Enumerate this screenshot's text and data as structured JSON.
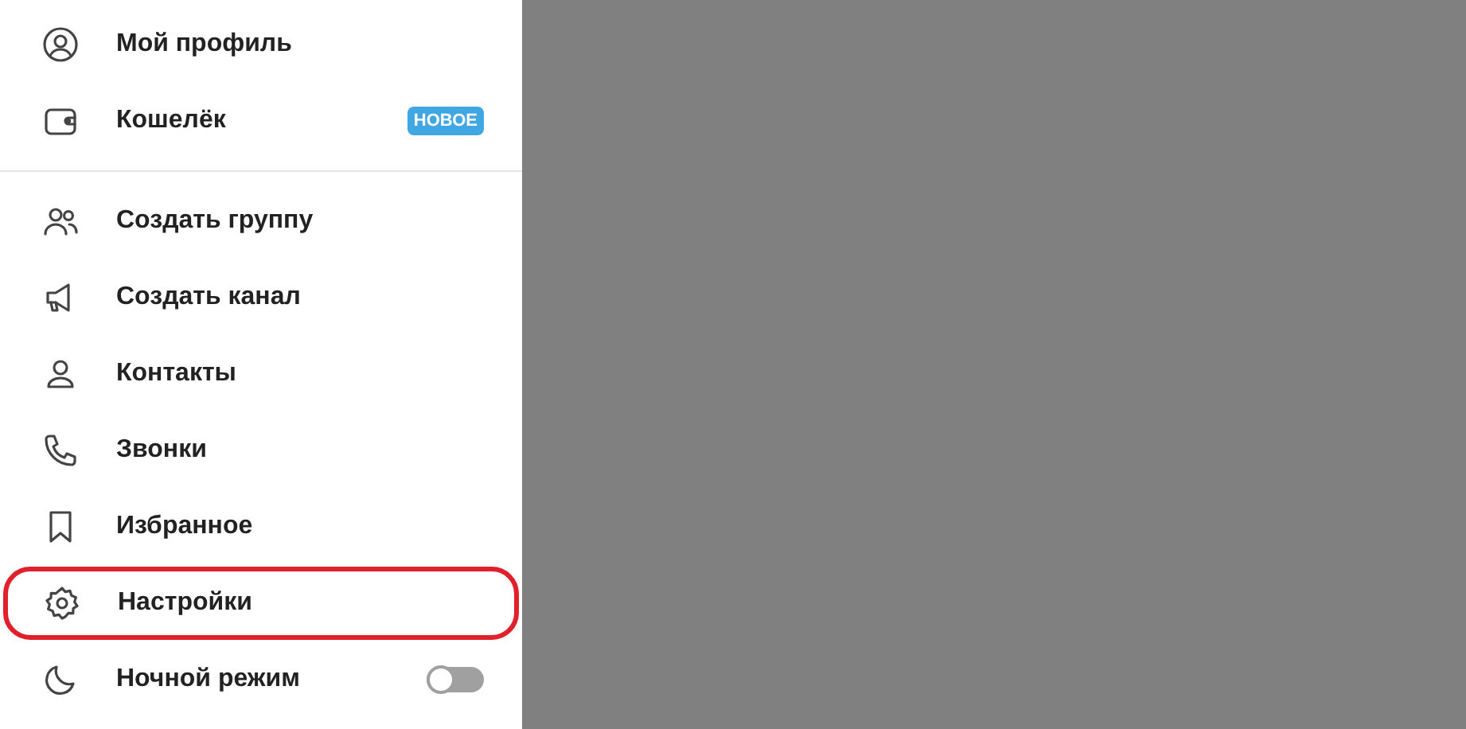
{
  "menu": {
    "groups": [
      {
        "items": [
          {
            "label": "Мой профиль",
            "highlighted": false,
            "kind": "link"
          },
          {
            "label": "Кошелёк",
            "badge": "НОВОЕ",
            "highlighted": false,
            "kind": "link"
          }
        ]
      },
      {
        "items": [
          {
            "label": "Создать группу",
            "highlighted": false,
            "kind": "link"
          },
          {
            "label": "Создать канал",
            "highlighted": false,
            "kind": "link"
          },
          {
            "label": "Контакты",
            "highlighted": false,
            "kind": "link"
          },
          {
            "label": "Звонки",
            "highlighted": false,
            "kind": "link"
          },
          {
            "label": "Избранное",
            "highlighted": false,
            "kind": "link"
          },
          {
            "label": "Настройки",
            "highlighted": true,
            "kind": "link"
          },
          {
            "label": "Ночной режим",
            "highlighted": false,
            "kind": "toggle",
            "on": false
          }
        ]
      }
    ]
  }
}
